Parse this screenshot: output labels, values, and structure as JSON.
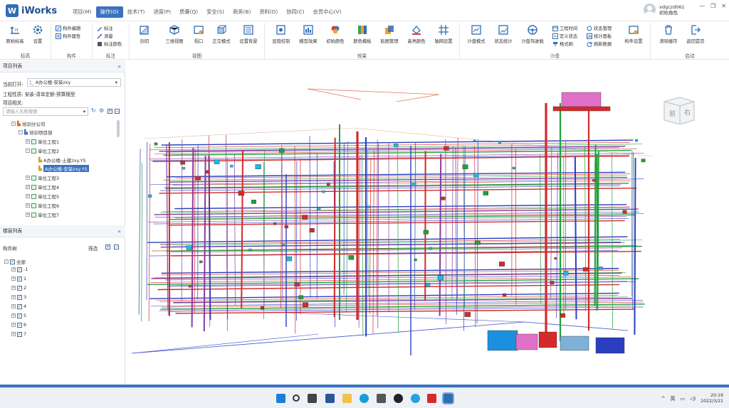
{
  "app": {
    "name": "iWorks"
  },
  "menus": [
    "项目(M)",
    "操作(O)",
    "技术(T)",
    "进度(P)",
    "质量(Q)",
    "安全(S)",
    "商务(B)",
    "资料(D)",
    "协同(C)",
    "会员中心(V)"
  ],
  "active_menu": "操作(O)",
  "user": {
    "name": "xdgczd061",
    "role": "初始角色"
  },
  "window_controls": [
    "—",
    "❐",
    "✕"
  ],
  "ribbon": {
    "groups": [
      "标高",
      "构件",
      "标注",
      "视图",
      "效果",
      "沙盘",
      "启动"
    ],
    "elevation": {
      "original": "原始标高",
      "settings": "设置"
    },
    "component": {
      "edit": "构件编辑",
      "props": "构件属性"
    },
    "annotation": {
      "mark": "标注",
      "measure": "测量",
      "color": "标注颜色"
    },
    "view": {
      "cut": "剖切",
      "three": "三维视图",
      "viewport": "视口",
      "ortho": "正交模式",
      "bg": "设置背景"
    },
    "effect": {
      "hide": "显隐控制",
      "model": "模型效果",
      "init_color": "初始颜色",
      "color_tpl": "颜色模板",
      "texture": "贴图管理",
      "highlight": "高亮颜色",
      "axis": "轴网设置"
    },
    "sandbox": {
      "mode": "沙盘模式",
      "stat": "状态统计",
      "drive": "沙盘驾驶舱",
      "eng_time": "工程时间",
      "def_state": "定义状态",
      "format": "格式刷",
      "state_mgr": "状态管理",
      "stat_panel": "统计面板",
      "refresh": "刷新数据",
      "comp_set": "构件设置"
    },
    "start": {
      "clear": "清除缓存",
      "home": "返回首页"
    }
  },
  "project_panel": {
    "title": "项目列表",
    "current_label": "当前打开:",
    "current_value": "A办公楼-安装zxy",
    "nature_label": "工程性质:",
    "nature_value": "安装-清单定额-预算模型",
    "related_label": "项目相关:",
    "search_placeholder": "请输入名称搜索",
    "tree": [
      {
        "label": "培训分公司"
      },
      {
        "label": "培训项目部"
      },
      {
        "label": "单位工程1"
      },
      {
        "label": "单位工程2"
      },
      {
        "label": "A办公楼-土建zxy.YS"
      },
      {
        "label": "A办公楼-安装zxy.YS"
      },
      {
        "label": "单位工程3"
      },
      {
        "label": "单位工程4"
      },
      {
        "label": "单位工程5"
      },
      {
        "label": "单位工程6"
      },
      {
        "label": "单位工程7"
      }
    ]
  },
  "floor_panel": {
    "title": "楼层列表",
    "tree_label": "构件树",
    "filter_label": "筛选",
    "all_label": "全部",
    "floors": [
      "-1",
      "1",
      "2",
      "3",
      "4",
      "5",
      "6",
      "7"
    ]
  },
  "viewcube": {
    "front": "前",
    "right": "右"
  },
  "taskbar": {
    "lang": "英",
    "time": "20:19",
    "date": "2022/3/21"
  },
  "colors": {
    "accent": "#3b72c0",
    "pipe_red": "#d42a2a",
    "pipe_blue": "#2a3fbf",
    "pipe_green": "#22a03a",
    "pipe_purple": "#8a3aa0"
  }
}
